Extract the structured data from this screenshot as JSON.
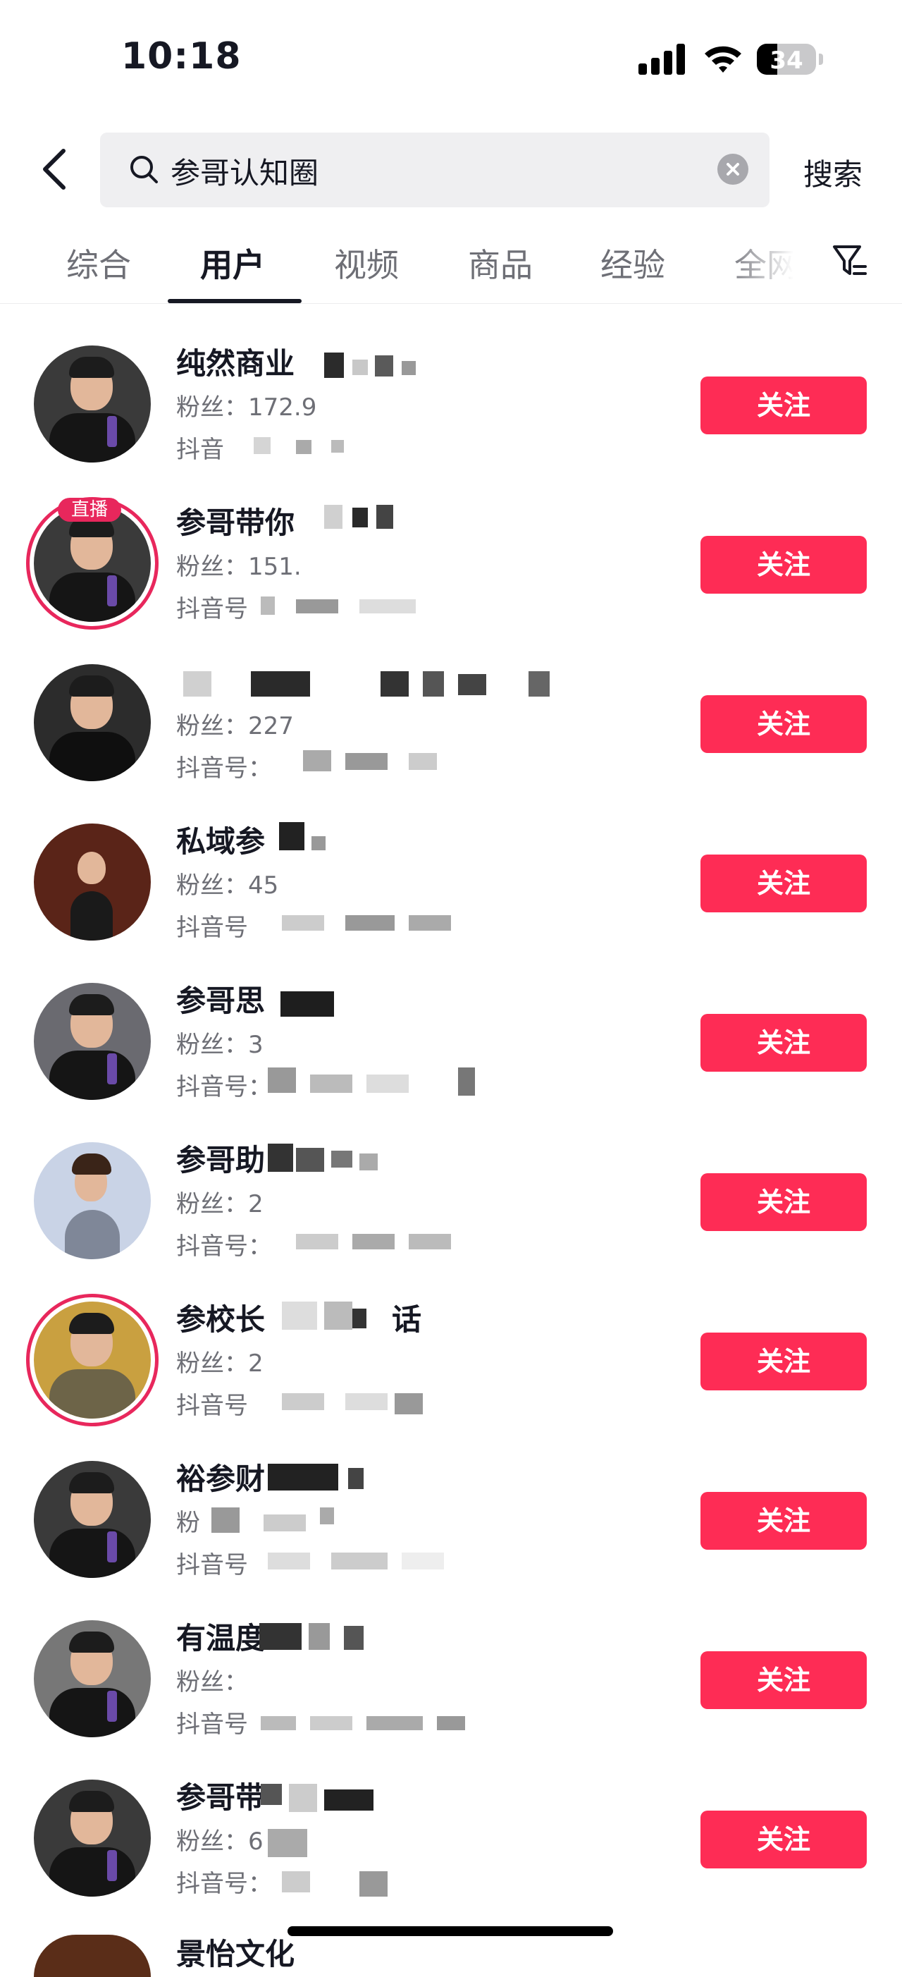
{
  "status_bar": {
    "time": "10:18",
    "battery": "34",
    "battery_level": 0.34
  },
  "search": {
    "query": "参哥认知圈",
    "button_label": "搜索"
  },
  "tabs": [
    {
      "label": "综合",
      "active": false
    },
    {
      "label": "用户",
      "active": true
    },
    {
      "label": "视频",
      "active": false
    },
    {
      "label": "商品",
      "active": false
    },
    {
      "label": "经验",
      "active": false
    },
    {
      "label": "全网",
      "active": false
    }
  ],
  "follow_label": "关注",
  "users": [
    {
      "name": "纯然商业",
      "fans": "粉丝：172.9",
      "douyin": "抖音",
      "live": false
    },
    {
      "name": "参哥带你",
      "fans": "粉丝：151.",
      "douyin": "抖音号",
      "live": true,
      "live_label": "直播"
    },
    {
      "name": "",
      "fans": "粉丝：227",
      "douyin": "抖音号：",
      "live": false
    },
    {
      "name": "私域参",
      "fans": "粉丝：45",
      "douyin": "抖音号",
      "live": false
    },
    {
      "name": "参哥思",
      "fans": "粉丝：3",
      "douyin": "抖音号：",
      "live": false
    },
    {
      "name": "参哥助",
      "fans": "粉丝：2",
      "douyin": "抖音号：",
      "live": false
    },
    {
      "name": "参校长",
      "name_suffix": "话",
      "fans": "粉丝：2",
      "douyin": "抖音号",
      "live": false
    },
    {
      "name": "裕参财",
      "fans": "粉",
      "douyin": "抖音号",
      "live": false
    },
    {
      "name": "有温度",
      "fans": "粉丝：",
      "douyin": "抖音号",
      "live": false
    },
    {
      "name": "参哥带",
      "fans": "粉丝：6",
      "douyin": "抖音号：",
      "live": false
    }
  ],
  "partial_user": {
    "name": "景怡文化"
  },
  "colors": {
    "follow": "#fe2c55",
    "live_ring": "#e8275c",
    "text_primary": "#161823",
    "text_secondary": "#6e6f76"
  },
  "icons": [
    "back-arrow-icon",
    "search-icon",
    "clear-icon",
    "filter-icon",
    "signal-icon",
    "wifi-icon",
    "battery-icon"
  ]
}
